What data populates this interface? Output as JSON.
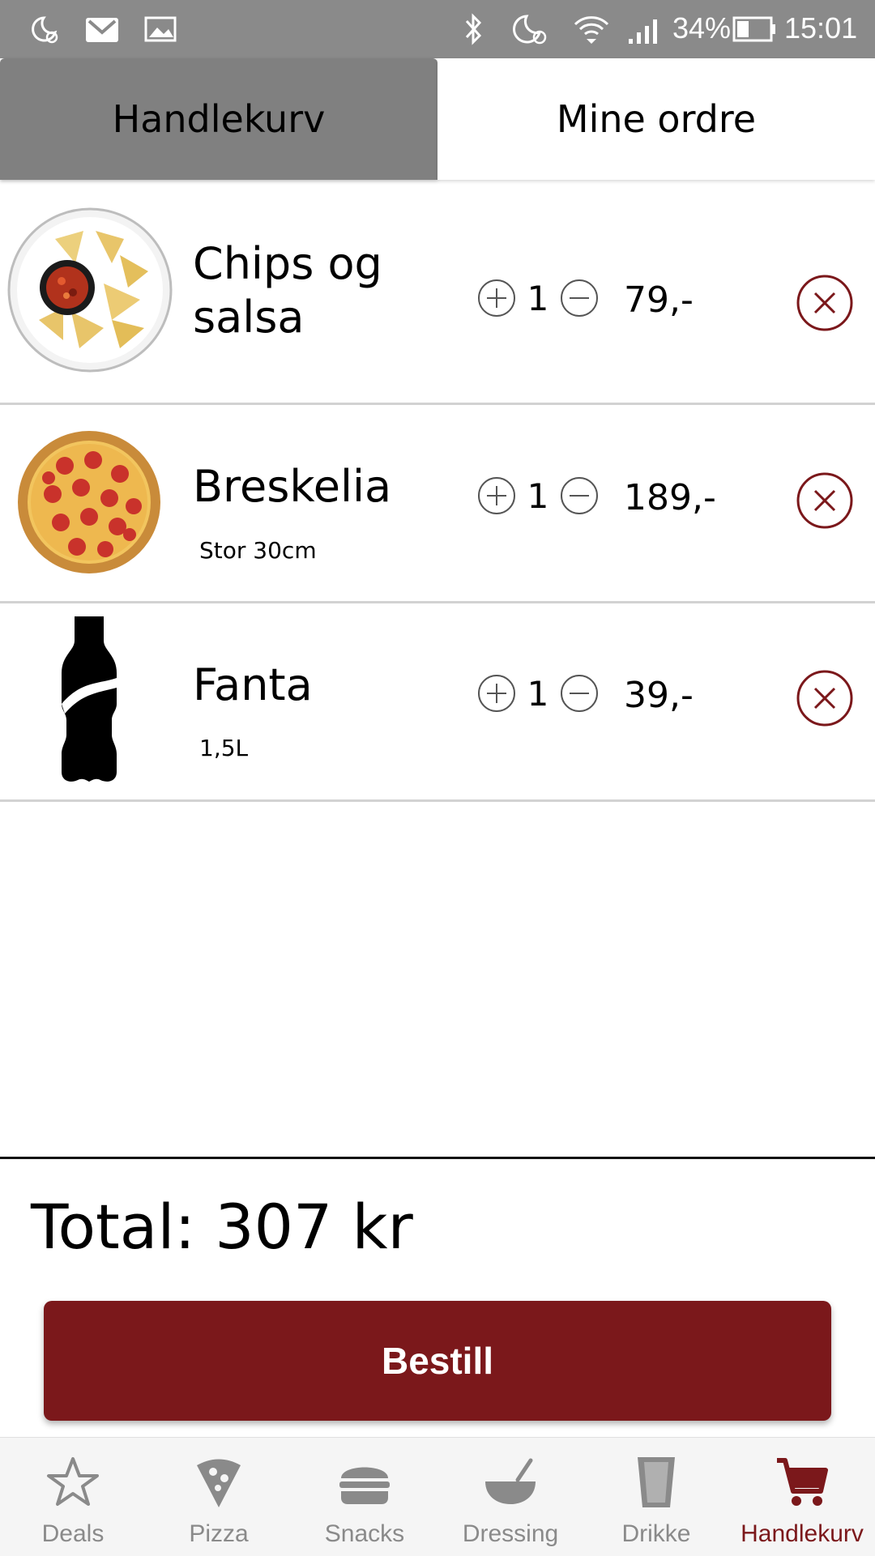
{
  "status_bar": {
    "battery": "34%",
    "time": "15:01"
  },
  "tabs": [
    {
      "label": "Handlekurv"
    },
    {
      "label": "Mine ordre"
    }
  ],
  "cart": {
    "items": [
      {
        "name": "Chips og salsa",
        "variant": "",
        "quantity": "1",
        "price": "79,-"
      },
      {
        "name": "Breskelia",
        "variant": "Stor 30cm",
        "quantity": "1",
        "price": "189,-"
      },
      {
        "name": "Fanta",
        "variant": "1,5L",
        "quantity": "1",
        "price": "39,-"
      }
    ],
    "total_label": "Total: 307 kr",
    "order_button": "Bestill"
  },
  "nav": [
    {
      "label": "Deals",
      "icon": "star-icon"
    },
    {
      "label": "Pizza",
      "icon": "pizza-slice-icon"
    },
    {
      "label": "Snacks",
      "icon": "burger-icon"
    },
    {
      "label": "Dressing",
      "icon": "bowl-icon"
    },
    {
      "label": "Drikke",
      "icon": "glass-icon"
    },
    {
      "label": "Handlekurv",
      "icon": "cart-icon"
    }
  ],
  "colors": {
    "accent": "#7b181b",
    "inactive": "#8a8a8a",
    "status_bar": "#8a8a8a",
    "tab_active": "#808080"
  }
}
